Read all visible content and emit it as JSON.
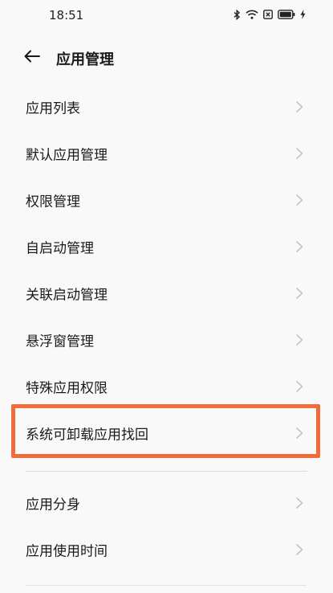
{
  "status": {
    "time": "18:51",
    "icons": [
      "bluetooth-icon",
      "wifi-icon",
      "close-box-icon",
      "battery-icon",
      "charging-icon"
    ]
  },
  "header": {
    "title": "应用管理",
    "back_icon": "back-arrow-icon"
  },
  "menu": {
    "group1": [
      {
        "label": "应用列表"
      },
      {
        "label": "默认应用管理"
      },
      {
        "label": "权限管理"
      },
      {
        "label": "自启动管理"
      },
      {
        "label": "关联启动管理"
      },
      {
        "label": "悬浮窗管理"
      },
      {
        "label": "特殊应用权限"
      },
      {
        "label": "系统可卸载应用找回"
      }
    ],
    "group2": [
      {
        "label": "应用分身"
      },
      {
        "label": "应用使用时间"
      }
    ]
  },
  "colors": {
    "highlight": "#f26b3a",
    "background": "#f9f9f9",
    "chevron": "#c4c4c4"
  }
}
